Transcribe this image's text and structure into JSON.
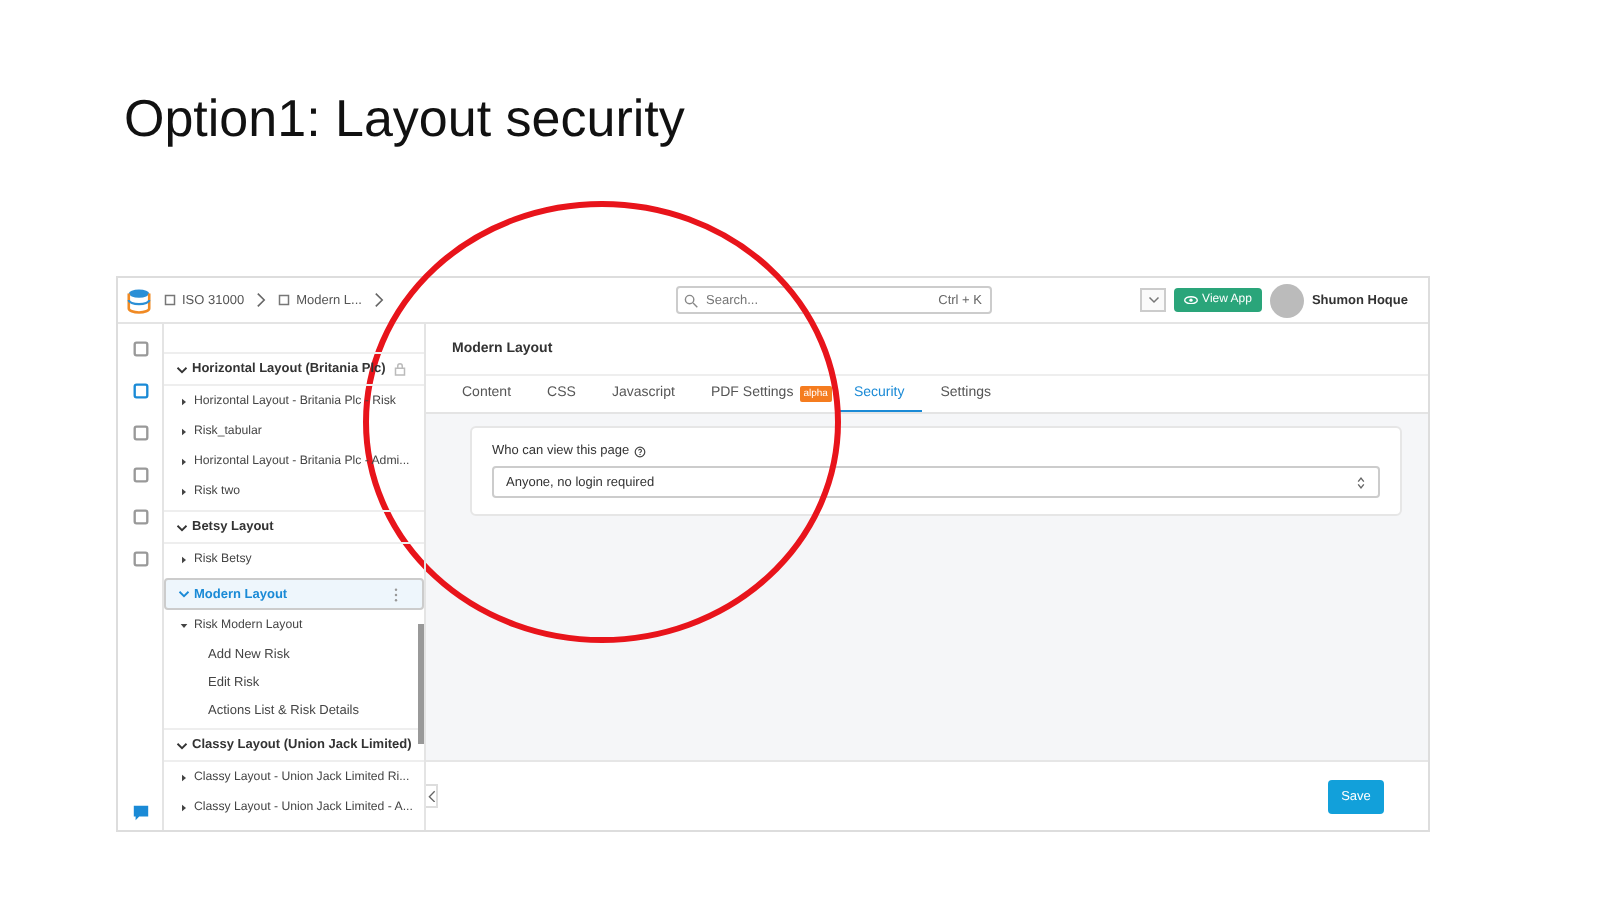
{
  "slide_title": "Option1: Layout security",
  "topbar": {
    "breadcrumbs": [
      "ISO 31000",
      "Modern L..."
    ],
    "search": {
      "placeholder": "Search...",
      "shortcut": "Ctrl + K"
    },
    "view_app": "View App",
    "user": "Shumon Hoque"
  },
  "sidebar": {
    "groups": [
      {
        "title": "Horizontal Layout (Britania Plc)",
        "expanded": true,
        "selected": false,
        "locked": true,
        "items": [
          {
            "label": "Horizontal Layout - Britania Plc - Risk",
            "expanded": false
          },
          {
            "label": "Risk_tabular",
            "expanded": false
          },
          {
            "label": "Horizontal Layout - Britania Plc - Admi...",
            "expanded": false
          },
          {
            "label": "Risk two",
            "expanded": false
          }
        ]
      },
      {
        "title": "Betsy Layout",
        "expanded": true,
        "selected": false,
        "locked": false,
        "items": [
          {
            "label": "Risk Betsy",
            "expanded": false
          }
        ]
      },
      {
        "title": "Modern Layout",
        "expanded": true,
        "selected": true,
        "locked": false,
        "items": [
          {
            "label": "Risk Modern Layout",
            "expanded": true,
            "children": [
              {
                "label": "Add New Risk"
              },
              {
                "label": "Edit Risk"
              },
              {
                "label": "Actions List & Risk Details"
              }
            ]
          }
        ]
      },
      {
        "title": "Classy Layout (Union Jack Limited)",
        "expanded": true,
        "selected": false,
        "locked": false,
        "items": [
          {
            "label": "Classy Layout - Union Jack Limited Ri...",
            "expanded": false
          },
          {
            "label": "Classy Layout - Union Jack Limited - A...",
            "expanded": false
          }
        ]
      }
    ]
  },
  "page": {
    "title": "Modern Layout",
    "tabs": [
      {
        "label": "Content",
        "selected": false
      },
      {
        "label": "CSS",
        "selected": false
      },
      {
        "label": "Javascript",
        "selected": false
      },
      {
        "label": "PDF Settings",
        "selected": false,
        "badge": "alpha"
      },
      {
        "label": "Security",
        "selected": true
      },
      {
        "label": "Settings",
        "selected": false
      }
    ],
    "field": {
      "label": "Who can view this page",
      "value": "Anyone, no login required"
    },
    "save": "Save"
  }
}
